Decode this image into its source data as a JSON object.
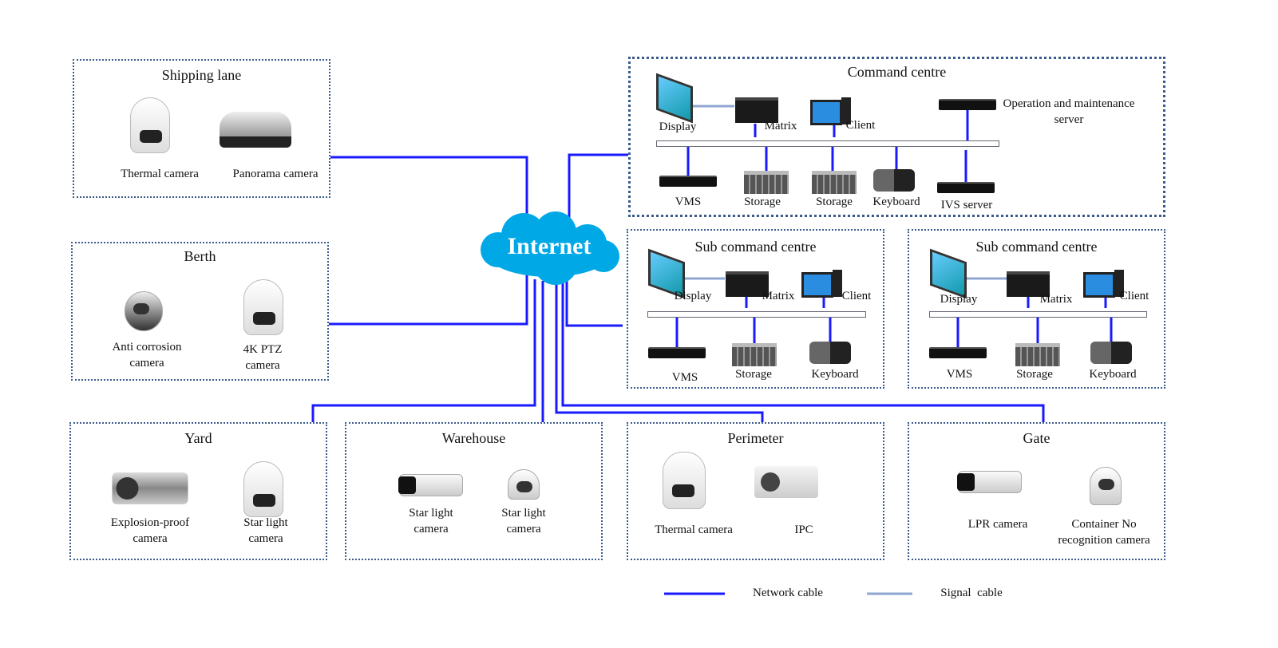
{
  "cloud": {
    "label": "Internet",
    "color": "#00a8e6"
  },
  "colors": {
    "network": "#1a1aff",
    "signal": "#8fa7d0"
  },
  "shipping": {
    "title": "Shipping lane",
    "devices": [
      "Thermal camera",
      "Panorama camera"
    ]
  },
  "berth": {
    "title": "Berth",
    "devices": [
      [
        "Anti corrosion",
        "camera"
      ],
      [
        "4K PTZ",
        "camera"
      ]
    ]
  },
  "command": {
    "title": "Command centre",
    "devices": [
      "Display",
      "Matrix",
      "Client",
      "Operation and maintenance",
      "server",
      "VMS",
      "Storage",
      "Storage",
      "Keyboard",
      "IVS server"
    ]
  },
  "sub1": {
    "title": "Sub command centre",
    "devices": [
      "Display",
      "Matrix",
      "Client",
      "VMS",
      "Storage",
      "Keyboard"
    ]
  },
  "sub2": {
    "title": "Sub command centre",
    "devices": [
      "Display",
      "Matrix",
      "Client",
      "VMS",
      "Storage",
      "Keyboard"
    ]
  },
  "yard": {
    "title": "Yard",
    "devices": [
      [
        "Explosion-proof",
        "camera"
      ],
      [
        "Star light",
        "camera"
      ]
    ]
  },
  "warehouse": {
    "title": "Warehouse",
    "devices": [
      [
        "Star light",
        "camera"
      ],
      [
        "Star light",
        "camera"
      ]
    ]
  },
  "perimeter": {
    "title": "Perimeter",
    "devices": [
      "Thermal camera",
      "IPC"
    ]
  },
  "gate": {
    "title": "Gate",
    "devices": [
      "LPR camera",
      [
        "Container No",
        "recognition camera"
      ]
    ]
  },
  "legend": {
    "network": "Network cable",
    "signal": "Signal  cable"
  }
}
